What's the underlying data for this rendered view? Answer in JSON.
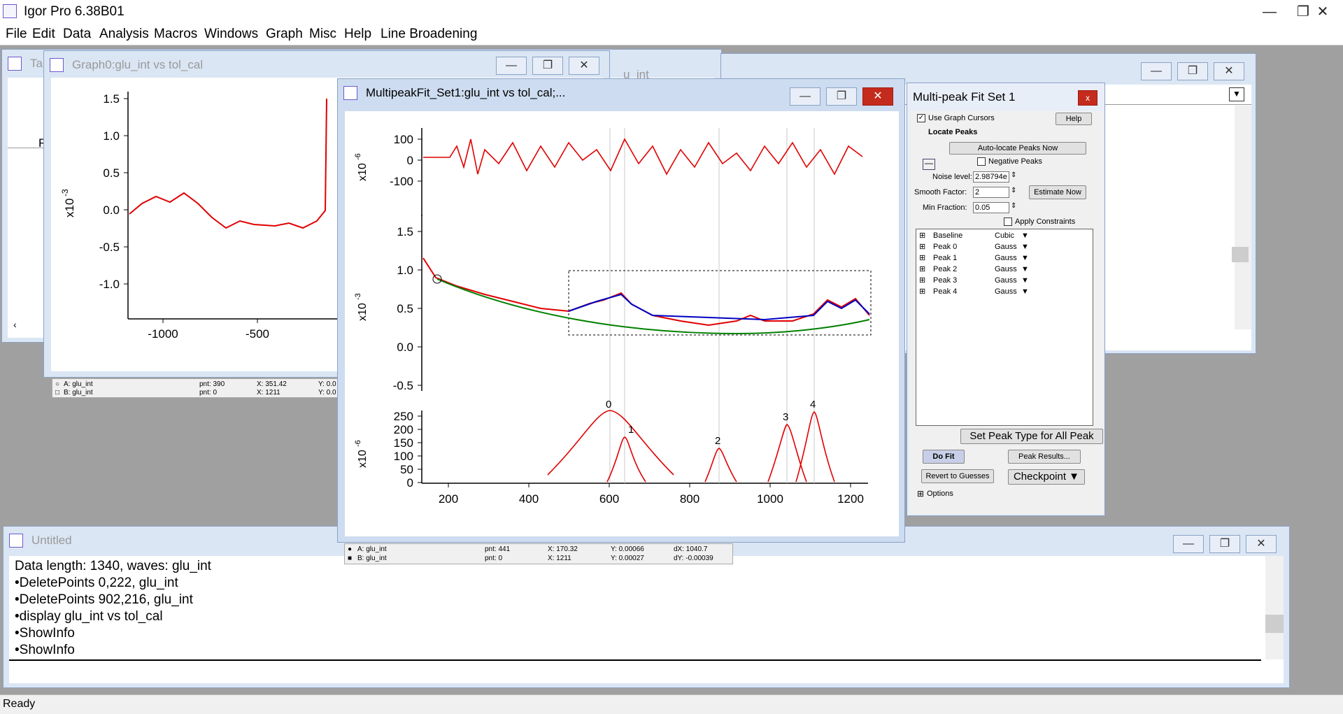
{
  "app": {
    "title": "Igor Pro 6.38B01",
    "status": "Ready"
  },
  "menus": [
    "File",
    "Edit",
    "Data",
    "Analysis",
    "Macros",
    "Windows",
    "Graph",
    "Misc",
    "Help",
    "Line Broadening"
  ],
  "table_window": {
    "title": "Tal",
    "title_right": "u_int",
    "cell_head": "F"
  },
  "graph0": {
    "title": "Graph0:glu_int vs tol_cal",
    "ylabel": "x10",
    "ylabel_exp": "-3",
    "yticks": [
      "1.5",
      "1.0",
      "0.5",
      "0.0",
      "-0.5",
      "-1.0"
    ],
    "xticks": [
      "-1000",
      "-500"
    ],
    "info": {
      "a_label": "A: glu_int",
      "b_label": "B: glu_int",
      "a_pnt": "pnt: 390",
      "b_pnt": "pnt: 0",
      "a_x": "X: 351.42",
      "b_x": "X: 1211",
      "a_y": "Y: 0.0",
      "b_y": "Y: 0.0"
    }
  },
  "multipeak_graph": {
    "title": "MultipeakFit_Set1:glu_int vs tol_cal;...",
    "top": {
      "ylabel": "x10",
      "ylabel_exp": "-6",
      "yticks": [
        "100",
        "0",
        "-100"
      ]
    },
    "middle": {
      "ylabel": "x10",
      "ylabel_exp": "-3",
      "yticks": [
        "1.5",
        "1.0",
        "0.5",
        "0.0",
        "-0.5"
      ]
    },
    "bottom": {
      "ylabel": "x10",
      "ylabel_exp": "-6",
      "yticks": [
        "250",
        "200",
        "150",
        "100",
        "50",
        "0"
      ]
    },
    "xticks": [
      "200",
      "400",
      "600",
      "800",
      "1000",
      "1200"
    ],
    "peak_labels": [
      "0",
      "1",
      "2",
      "3",
      "4"
    ],
    "info": {
      "a_label": "A: glu_int",
      "b_label": "B: glu_int",
      "a_pnt": "pnt: 441",
      "b_pnt": "pnt: 0",
      "a_x": "X: 170.32",
      "b_x": "X: 1211",
      "a_y": "Y: 0.00066",
      "b_y": "Y: 0.00027",
      "dx": "dX: 1040.7",
      "dy": "dY: -0.00039"
    }
  },
  "chart_data": [
    {
      "type": "line",
      "title": "",
      "xlabel": "",
      "ylabel": "x10-6",
      "xlim": [
        100,
        1220
      ],
      "ylim": [
        -150,
        150
      ],
      "series": [
        {
          "name": "",
          "values": []
        }
      ]
    },
    {
      "type": "line",
      "title": "",
      "xlabel": "",
      "ylabel": "x10-3",
      "xlim": [
        100,
        1220
      ],
      "ylim": [
        -0.55,
        1.7
      ],
      "series": [
        {
          "name": "",
          "x": [
            110,
            150,
            200,
            300,
            400,
            500,
            600,
            700,
            800,
            900,
            1000,
            1100,
            1200
          ],
          "y": [
            1.1,
            0.8,
            0.65,
            0.5,
            0.38,
            0.3,
            0.25,
            0.2,
            0.18,
            0.2,
            0.22,
            0.25,
            0.24
          ]
        }
      ]
    },
    {
      "type": "line",
      "title": "",
      "xlabel": "",
      "ylabel": "x10-6",
      "xlim": [
        100,
        1220
      ],
      "ylim": [
        0,
        280
      ],
      "series": [
        {
          "name": "0",
          "x": [
            568
          ],
          "y": [
            255
          ]
        },
        {
          "name": "1",
          "x": [
            620
          ],
          "y": [
            170
          ]
        },
        {
          "name": "2",
          "x": [
            910
          ],
          "y": [
            120
          ]
        },
        {
          "name": "3",
          "x": [
            1060
          ],
          "y": [
            210
          ]
        },
        {
          "name": "4",
          "x": [
            1125
          ],
          "y": [
            260
          ]
        }
      ]
    }
  ],
  "panel": {
    "title": "Multi-peak Fit Set 1",
    "use_cursors": "Use Graph Cursors",
    "help": "Help",
    "locate_peaks": "Locate Peaks",
    "auto_locate": "Auto-locate Peaks Now",
    "negative_peaks": "Negative Peaks",
    "noise_level_label": "Noise level:",
    "noise_level": "2.98794e",
    "smooth_label": "Smooth Factor:",
    "smooth": "2",
    "estimate": "Estimate Now",
    "min_frac_label": "Min Fraction:",
    "min_frac": "0.05",
    "apply_constraints": "Apply Constraints",
    "peaks": [
      {
        "name": "Baseline",
        "type": "Cubic"
      },
      {
        "name": "Peak 0",
        "type": "Gauss"
      },
      {
        "name": "Peak 1",
        "type": "Gauss"
      },
      {
        "name": "Peak 2",
        "type": "Gauss"
      },
      {
        "name": "Peak 3",
        "type": "Gauss"
      },
      {
        "name": "Peak 4",
        "type": "Gauss"
      }
    ],
    "set_peak_type": "Set Peak Type for All Peak",
    "do_fit": "Do Fit",
    "peak_results": "Peak Results...",
    "revert": "Revert to Guesses",
    "checkpoint": "Checkpoint",
    "options": "Options"
  },
  "command_window": {
    "title": "Untitled",
    "lines": [
      "  Data length: 1340, waves: glu_int",
      "•DeletePoints 0,222, glu_int",
      "•DeletePoints 902,216, glu_int",
      "•display glu_int vs tol_cal",
      "•ShowInfo",
      "•ShowInfo"
    ]
  }
}
